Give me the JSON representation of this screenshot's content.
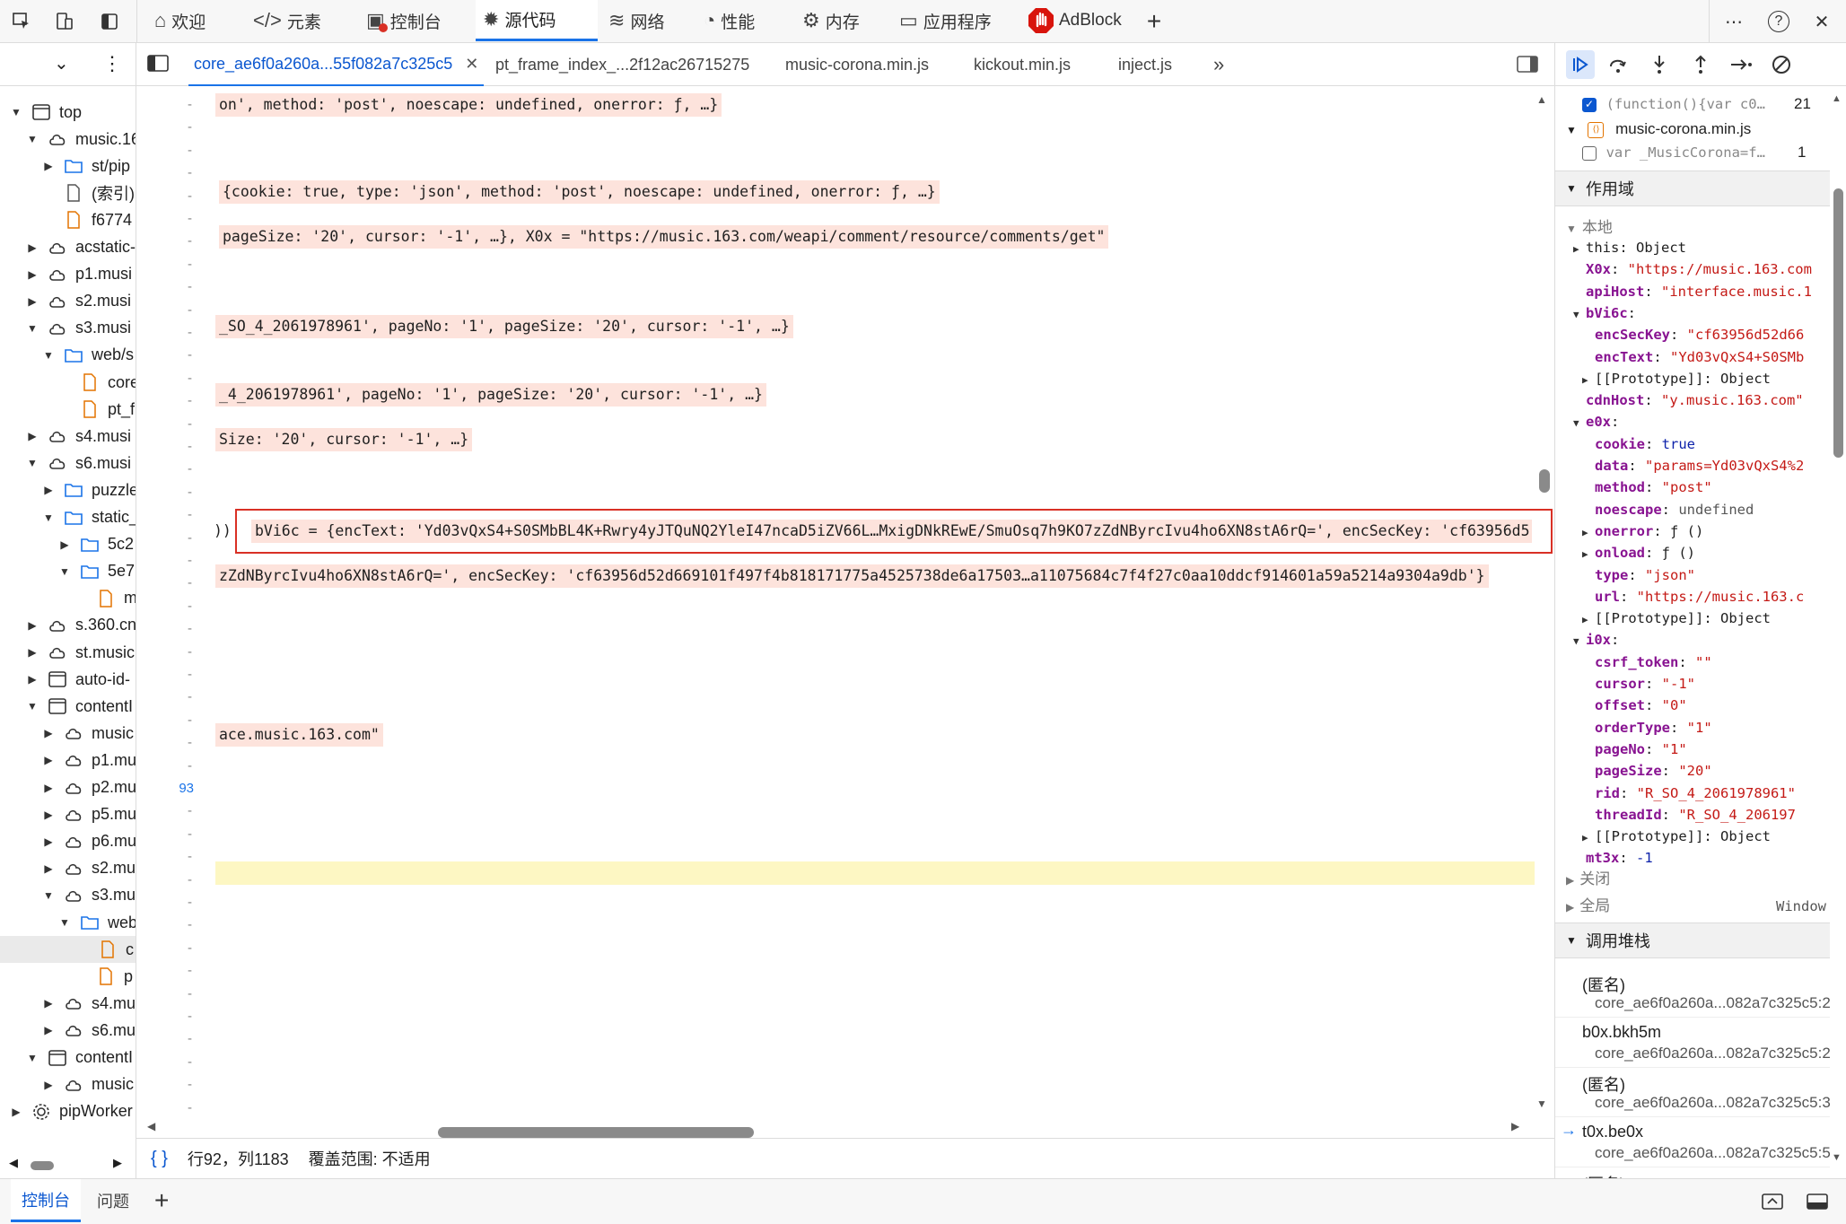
{
  "toolbar": {
    "tabs": [
      {
        "label": "欢迎",
        "icon": "home-icon"
      },
      {
        "label": "元素",
        "icon": "code-icon"
      },
      {
        "label": "控制台",
        "icon": "console-icon"
      },
      {
        "label": "源代码",
        "icon": "bug-icon"
      },
      {
        "label": "网络",
        "icon": "wifi-icon"
      },
      {
        "label": "性能",
        "icon": "gauge-icon"
      },
      {
        "label": "内存",
        "icon": "memory-icon"
      },
      {
        "label": "应用程序",
        "icon": "window-icon"
      },
      {
        "label": "AdBlock",
        "icon": "adblock-icon"
      }
    ],
    "add": "+",
    "more": "⋯",
    "help": "?",
    "close": "✕"
  },
  "file_tabs": [
    {
      "label": "core_ae6f0a260a...55f082a7c325c5",
      "close": "✕"
    },
    {
      "label": "pt_frame_index_...2f12ac26715275"
    },
    {
      "label": "music-corona.min.js"
    },
    {
      "label": "kickout.min.js"
    },
    {
      "label": "inject.js"
    }
  ],
  "navigator": {
    "items": [
      {
        "label": "top",
        "arrow": "▼",
        "icon": "frame"
      },
      {
        "label": "music.16",
        "arrow": "▼",
        "icon": "cloud"
      },
      {
        "label": "st/pip",
        "arrow": "▶",
        "icon": "folder"
      },
      {
        "label": "(索引)",
        "arrow": "",
        "icon": "file"
      },
      {
        "label": "f6774",
        "arrow": "",
        "icon": "file-orange"
      },
      {
        "label": "acstatic-",
        "arrow": "▶",
        "icon": "cloud"
      },
      {
        "label": "p1.musi",
        "arrow": "▶",
        "icon": "cloud"
      },
      {
        "label": "s2.musi",
        "arrow": "▶",
        "icon": "cloud"
      },
      {
        "label": "s3.musi",
        "arrow": "▼",
        "icon": "cloud"
      },
      {
        "label": "web/s",
        "arrow": "▼",
        "icon": "folder"
      },
      {
        "label": "core",
        "arrow": "",
        "icon": "file-orange"
      },
      {
        "label": "pt_f",
        "arrow": "",
        "icon": "file-orange"
      },
      {
        "label": "s4.musi",
        "arrow": "▶",
        "icon": "cloud"
      },
      {
        "label": "s6.musi",
        "arrow": "▼",
        "icon": "cloud"
      },
      {
        "label": "puzzle",
        "arrow": "▶",
        "icon": "folder"
      },
      {
        "label": "static_",
        "arrow": "▼",
        "icon": "folder"
      },
      {
        "label": "5c2",
        "arrow": "▶",
        "icon": "folder"
      },
      {
        "label": "5e7",
        "arrow": "▼",
        "icon": "folder"
      },
      {
        "label": "m",
        "arrow": "",
        "icon": "file-orange"
      },
      {
        "label": "s.360.cn",
        "arrow": "▶",
        "icon": "cloud"
      },
      {
        "label": "st.music",
        "arrow": "▶",
        "icon": "cloud"
      },
      {
        "label": "auto-id-",
        "arrow": "▶",
        "icon": "frame"
      },
      {
        "label": "contentI",
        "arrow": "▼",
        "icon": "frame"
      },
      {
        "label": "music",
        "arrow": "▶",
        "icon": "cloud"
      },
      {
        "label": "p1.mu",
        "arrow": "▶",
        "icon": "cloud"
      },
      {
        "label": "p2.mu",
        "arrow": "▶",
        "icon": "cloud"
      },
      {
        "label": "p5.mu",
        "arrow": "▶",
        "icon": "cloud"
      },
      {
        "label": "p6.mu",
        "arrow": "▶",
        "icon": "cloud"
      },
      {
        "label": "s2.mu",
        "arrow": "▶",
        "icon": "cloud"
      },
      {
        "label": "s3.mu",
        "arrow": "▼",
        "icon": "cloud"
      },
      {
        "label": "web",
        "arrow": "▼",
        "icon": "folder"
      },
      {
        "label": "c",
        "arrow": "",
        "icon": "file-orange"
      },
      {
        "label": "p",
        "arrow": "",
        "icon": "file-orange"
      },
      {
        "label": "s4.mu",
        "arrow": "▶",
        "icon": "cloud"
      },
      {
        "label": "s6.mu",
        "arrow": "▶",
        "icon": "cloud"
      },
      {
        "label": "contentI",
        "arrow": "▼",
        "icon": "frame"
      },
      {
        "label": "music",
        "arrow": "▶",
        "icon": "cloud"
      },
      {
        "label": "pipWorker",
        "arrow": "▶",
        "icon": "gear"
      }
    ]
  },
  "editor": {
    "line_number": "93",
    "lines": [
      "on', method: 'post', noescape: undefined, onerror: ƒ, …}",
      "{cookie: true, type: 'json', method: 'post', noescape: undefined, onerror: ƒ, …}",
      "pageSize: '20', cursor: '-1', …}, X0x = \"https://music.163.com/weapi/comment/resource/comments/get\"",
      "_SO_4_2061978961', pageNo: '1', pageSize: '20', cursor: '-1', …}",
      "_4_2061978961', pageNo: '1', pageSize: '20', cursor: '-1', …}",
      "Size: '20', cursor: '-1', …}",
      "bVi6c = {encText: 'Yd03vQxS4+S0SMbBL4K+Rwry4yJTQuNQ2YleI47ncaD5iZV66L…MxigDNkREwE/SmuOsq7h9KO7zZdNByrcIvu4ho6XN8stA6rQ=', encSecKey: 'cf63956d5",
      "zZdNByrcIvu4ho6XN8stA6rQ=', encSecKey: 'cf63956d52d669101f497f4b818171775a4525738de6a17503…a11075684c7f4f27c0aa10ddcf914601a59a5214a9304a9db'}",
      "ace.music.163.com\""
    ],
    "prefix": "))"
  },
  "status": {
    "braces": "{ }",
    "position": "行92，列1183",
    "coverage": "覆盖范围: 不适用"
  },
  "right": {
    "breakpoints": [
      {
        "text": "(function(){var c0…",
        "count": "21",
        "checked": true
      },
      {
        "file": "music-corona.min.js"
      },
      {
        "text": "var _MusicCorona=f…",
        "count": "1",
        "checked": false
      }
    ],
    "scope_title": "作用域",
    "local_title": "本地",
    "scope": [
      {
        "key": "this",
        "val": "Object",
        "indent": 1,
        "arrow": "▶"
      },
      {
        "key": "X0x",
        "val": "\"https://music.163.com",
        "indent": 1,
        "arrow": ""
      },
      {
        "key": "apiHost",
        "val": "\"interface.music.1",
        "indent": 1,
        "arrow": ""
      },
      {
        "key": "bVi6c",
        "val": "",
        "indent": 1,
        "arrow": "▼"
      },
      {
        "key": "encSecKey",
        "val": "\"cf63956d52d66",
        "indent": 2,
        "arrow": ""
      },
      {
        "key": "encText",
        "val": "\"Yd03vQxS4+S0SMb",
        "indent": 2,
        "arrow": ""
      },
      {
        "key": "[[Prototype]]",
        "val": "Object",
        "indent": 2,
        "arrow": "▶"
      },
      {
        "key": "cdnHost",
        "val": "\"y.music.163.com\"",
        "indent": 1,
        "arrow": ""
      },
      {
        "key": "e0x",
        "val": "",
        "indent": 1,
        "arrow": "▼"
      },
      {
        "key": "cookie",
        "val": "true",
        "indent": 2,
        "arrow": ""
      },
      {
        "key": "data",
        "val": "\"params=Yd03vQxS4%2",
        "indent": 2,
        "arrow": ""
      },
      {
        "key": "method",
        "val": "\"post\"",
        "indent": 2,
        "arrow": ""
      },
      {
        "key": "noescape",
        "val": "undefined",
        "indent": 2,
        "arrow": ""
      },
      {
        "key": "onerror",
        "val": "ƒ ()",
        "indent": 2,
        "arrow": "▶"
      },
      {
        "key": "onload",
        "val": "ƒ ()",
        "indent": 2,
        "arrow": "▶"
      },
      {
        "key": "type",
        "val": "\"json\"",
        "indent": 2,
        "arrow": ""
      },
      {
        "key": "url",
        "val": "\"https://music.163.c",
        "indent": 2,
        "arrow": ""
      },
      {
        "key": "[[Prototype]]",
        "val": "Object",
        "indent": 2,
        "arrow": "▶"
      },
      {
        "key": "i0x",
        "val": "",
        "indent": 1,
        "arrow": "▼"
      },
      {
        "key": "csrf_token",
        "val": "\"\"",
        "indent": 2,
        "arrow": ""
      },
      {
        "key": "cursor",
        "val": "\"-1\"",
        "indent": 2,
        "arrow": ""
      },
      {
        "key": "offset",
        "val": "\"0\"",
        "indent": 2,
        "arrow": ""
      },
      {
        "key": "orderType",
        "val": "\"1\"",
        "indent": 2,
        "arrow": ""
      },
      {
        "key": "pageNo",
        "val": "\"1\"",
        "indent": 2,
        "arrow": ""
      },
      {
        "key": "pageSize",
        "val": "\"20\"",
        "indent": 2,
        "arrow": ""
      },
      {
        "key": "rid",
        "val": "\"R_SO_4_2061978961\"",
        "indent": 2,
        "arrow": ""
      },
      {
        "key": "threadId",
        "val": "\"R_SO_4_206197",
        "indent": 2,
        "arrow": ""
      },
      {
        "key": "[[Prototype]]",
        "val": "Object",
        "indent": 2,
        "arrow": "▶"
      },
      {
        "key": "mt3x",
        "val": "-1",
        "indent": 1,
        "arrow": ""
      }
    ],
    "closure_title": "关闭",
    "global_title": "全局",
    "global_val": "Window",
    "callstack_title": "调用堆栈",
    "callstack": [
      {
        "fn": "(匿名)",
        "loc": "core_ae6f0a260a...082a7c325c5:2"
      },
      {
        "fn": "b0x.bkh5m",
        "loc": "core_ae6f0a260a...082a7c325c5:2"
      },
      {
        "fn": "(匿名)",
        "loc": "core_ae6f0a260a...082a7c325c5:3"
      },
      {
        "fn": "t0x.be0x",
        "loc": "core_ae6f0a260a...082a7c325c5:5"
      },
      {
        "fn": "(匿名)",
        "loc": ""
      }
    ]
  },
  "bottom": {
    "tabs": [
      {
        "label": "控制台"
      },
      {
        "label": "问题"
      }
    ],
    "add": "+"
  }
}
